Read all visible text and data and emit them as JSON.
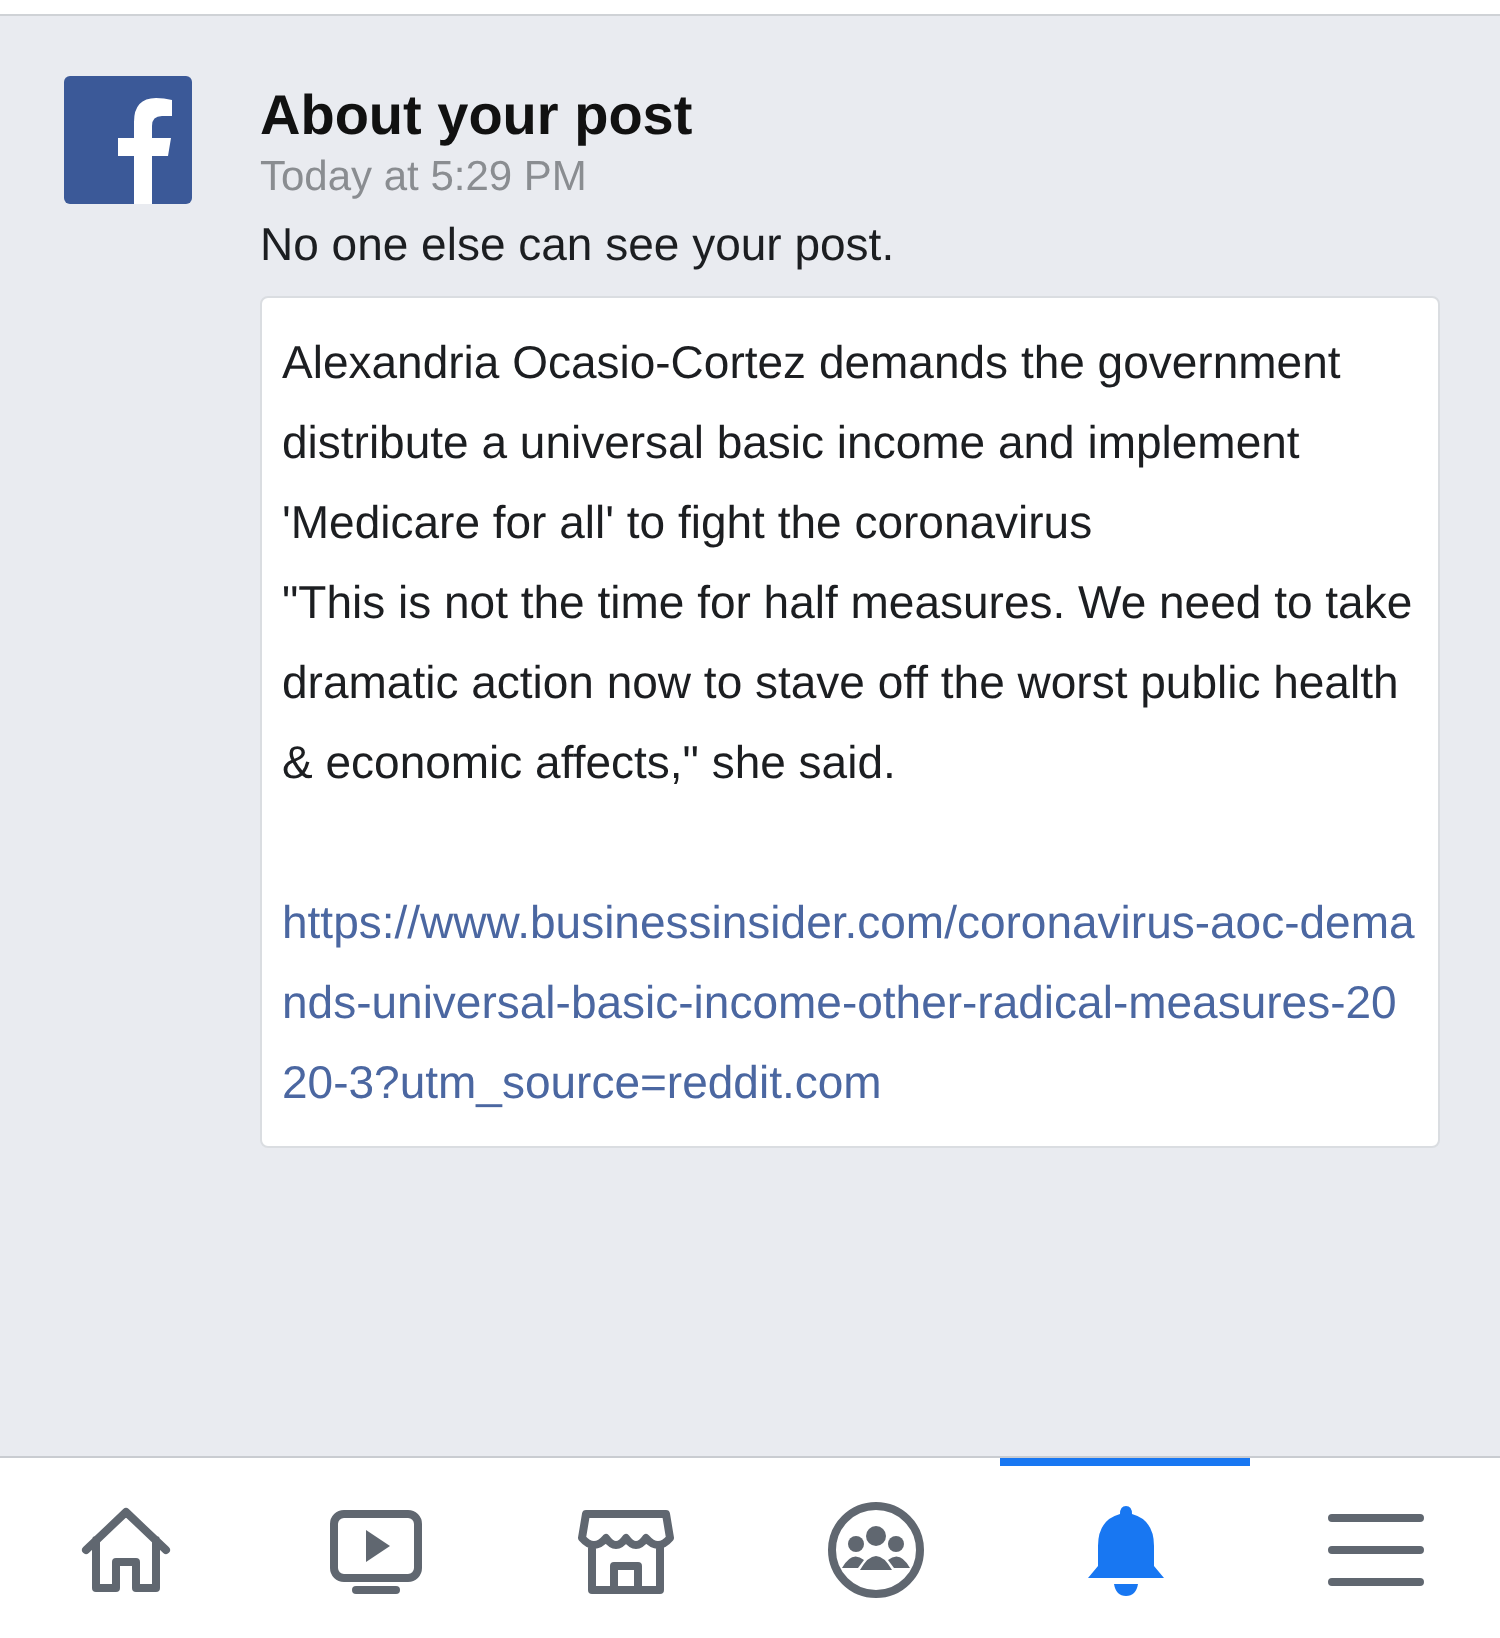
{
  "notification": {
    "title": "About your post",
    "time": "Today at 5:29 PM",
    "message": "No one else can see your post.",
    "post": {
      "paragraphs": [
        "Alexandria Ocasio-Cortez demands the government distribute a universal basic income and implement 'Medicare for all' to fight the coronavirus",
        "\"This is not the time for half measures. We need to take dramatic action now to stave off the worst public health & economic affects,\" she said."
      ],
      "link": "https://www.businessinsider.com/coronavirus-aoc-demands-universal-basic-income-other-radical-measures-2020-3?utm_source=reddit.com"
    }
  },
  "nav": [
    {
      "kind": "home",
      "selected": false
    },
    {
      "kind": "video",
      "selected": false
    },
    {
      "kind": "marketplace",
      "selected": false
    },
    {
      "kind": "groups",
      "selected": false
    },
    {
      "kind": "notifications",
      "selected": true
    },
    {
      "kind": "menu",
      "selected": false
    }
  ]
}
